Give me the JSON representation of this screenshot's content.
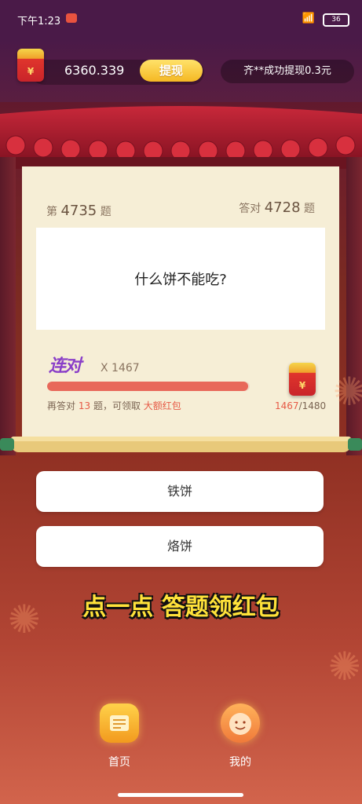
{
  "status_bar": {
    "time": "下午1:23",
    "wifi_icon": "wifi-icon",
    "battery": "36"
  },
  "top_bar": {
    "balance": "6360.339",
    "withdraw_label": "提现",
    "notice": "齐**成功提现0.3元"
  },
  "question": {
    "number_prefix": "第",
    "number": "4735",
    "number_suffix": "题",
    "correct_prefix": "答对",
    "correct": "4728",
    "correct_suffix": "题",
    "text": "什么饼不能吃?"
  },
  "combo": {
    "logo": "连对",
    "count": "X 1467",
    "progress": 0.991,
    "hint_prefix": "再答对",
    "hint_remaining": "13",
    "hint_mid": "题，可领取",
    "hint_reward": "大额红包",
    "rp_current": "1467",
    "rp_total": "/1480"
  },
  "answers": [
    {
      "label": "铁饼"
    },
    {
      "label": "烙饼"
    }
  ],
  "promo_text": "点一点 答题领红包",
  "nav": [
    {
      "label": "首页",
      "icon": "home-icon"
    },
    {
      "label": "我的",
      "icon": "profile-icon"
    }
  ],
  "colors": {
    "accent_red": "#e65a46",
    "gold": "#f5b823",
    "purple_top": "#4a1a48"
  }
}
